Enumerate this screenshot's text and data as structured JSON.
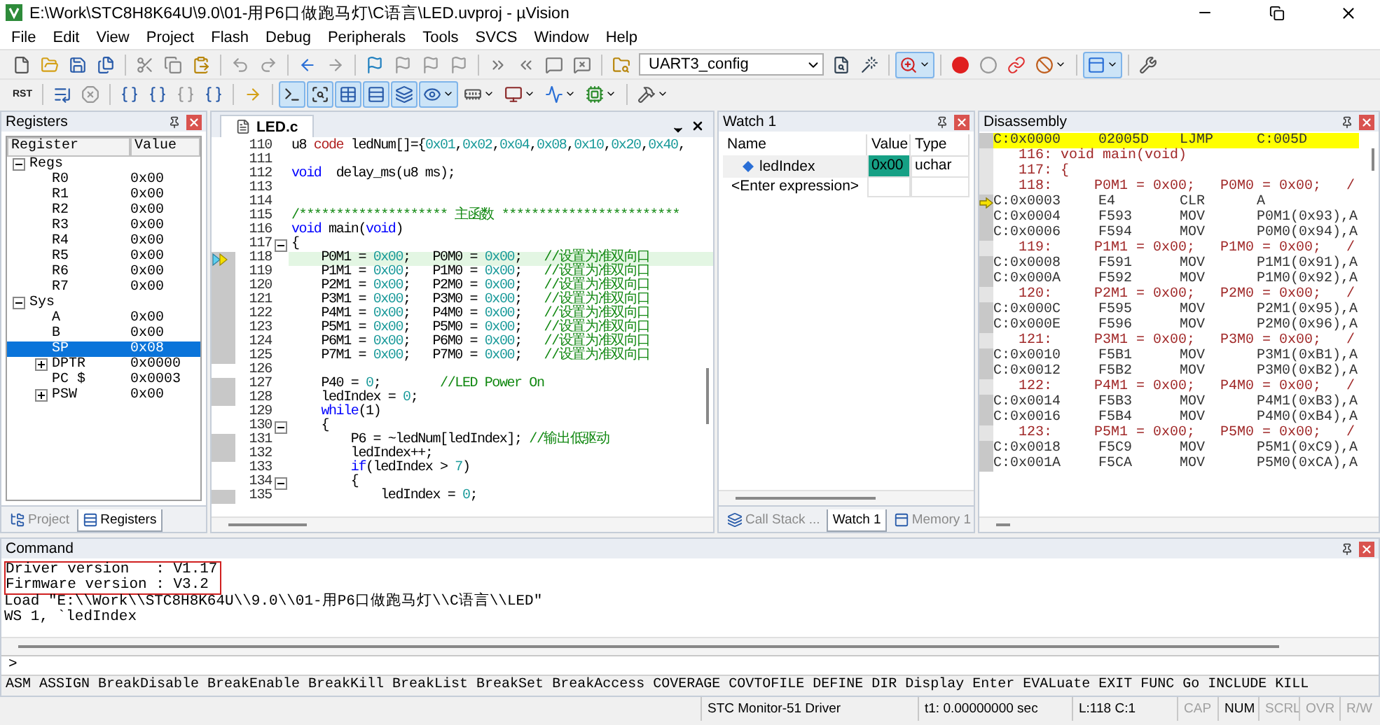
{
  "window": {
    "title": "E:\\Work\\STC8H8K64U\\9.0\\01-用P6口做跑马灯\\C语言\\LED.uvproj - µVision"
  },
  "menu": [
    "File",
    "Edit",
    "View",
    "Project",
    "Flash",
    "Debug",
    "Peripherals",
    "Tools",
    "SVCS",
    "Window",
    "Help"
  ],
  "toolbar_1": [
    {
      "kind": "button",
      "pressed": false
    },
    {
      "kind": "button",
      "pressed": false
    },
    {
      "kind": "button",
      "pressed": false
    },
    {
      "kind": "button",
      "pressed": false
    },
    {
      "kind": "separator"
    },
    {
      "kind": "button",
      "pressed": false
    },
    {
      "kind": "button",
      "pressed": false
    },
    {
      "kind": "button",
      "pressed": false
    },
    {
      "kind": "separator"
    },
    {
      "kind": "button",
      "pressed": false
    },
    {
      "kind": "button",
      "pressed": false
    },
    {
      "kind": "separator"
    },
    {
      "kind": "button",
      "pressed": false
    },
    {
      "kind": "button",
      "pressed": false
    },
    {
      "kind": "separator"
    },
    {
      "kind": "button",
      "pressed": false
    },
    {
      "kind": "button",
      "pressed": false
    },
    {
      "kind": "button",
      "pressed": false
    },
    {
      "kind": "button",
      "pressed": false
    },
    {
      "kind": "separator"
    },
    {
      "kind": "button",
      "pressed": false
    },
    {
      "kind": "button",
      "pressed": false
    },
    {
      "kind": "button",
      "pressed": false
    },
    {
      "kind": "button",
      "pressed": false
    },
    {
      "kind": "separator"
    },
    {
      "kind": "button",
      "pressed": false
    },
    {
      "kind": "select",
      "value": "UART3_config"
    },
    {
      "kind": "button",
      "pressed": false
    },
    {
      "kind": "button",
      "pressed": false
    },
    {
      "kind": "separator"
    },
    {
      "kind": "split",
      "pressed": true
    },
    {
      "kind": "separator"
    },
    {
      "kind": "button",
      "pressed": false
    },
    {
      "kind": "button",
      "pressed": false
    },
    {
      "kind": "button",
      "pressed": false
    },
    {
      "kind": "split",
      "pressed": false
    },
    {
      "kind": "separator"
    },
    {
      "kind": "split",
      "pressed": true
    },
    {
      "kind": "separator"
    },
    {
      "kind": "button",
      "pressed": false
    }
  ],
  "toolbar_2": [
    {
      "kind": "text_button",
      "label": "RST"
    },
    {
      "kind": "separator"
    },
    {
      "kind": "button",
      "pressed": false
    },
    {
      "kind": "button",
      "pressed": false
    },
    {
      "kind": "separator"
    },
    {
      "kind": "button",
      "pressed": false
    },
    {
      "kind": "button",
      "pressed": false
    },
    {
      "kind": "button",
      "pressed": false
    },
    {
      "kind": "button",
      "pressed": false
    },
    {
      "kind": "separator"
    },
    {
      "kind": "button",
      "pressed": false
    },
    {
      "kind": "separator"
    },
    {
      "kind": "button",
      "pressed": true
    },
    {
      "kind": "button",
      "pressed": true
    },
    {
      "kind": "button",
      "pressed": true
    },
    {
      "kind": "button",
      "pressed": true
    },
    {
      "kind": "button",
      "pressed": true
    },
    {
      "kind": "split",
      "pressed": true
    },
    {
      "kind": "split",
      "pressed": false
    },
    {
      "kind": "split",
      "pressed": false
    },
    {
      "kind": "split",
      "pressed": false
    },
    {
      "kind": "split",
      "pressed": false
    },
    {
      "kind": "separator"
    },
    {
      "kind": "split",
      "pressed": false
    }
  ],
  "registers": {
    "title": "Registers",
    "columns": [
      "Register",
      "Value"
    ],
    "rows": [
      {
        "name": "Regs",
        "expanded": true,
        "selected": false,
        "children": [
          {
            "name": "R0",
            "value": "0x00",
            "selected": false
          },
          {
            "name": "R1",
            "value": "0x00",
            "selected": false
          },
          {
            "name": "R2",
            "value": "0x00",
            "selected": false
          },
          {
            "name": "R3",
            "value": "0x00",
            "selected": false
          },
          {
            "name": "R4",
            "value": "0x00",
            "selected": false
          },
          {
            "name": "R5",
            "value": "0x00",
            "selected": false
          },
          {
            "name": "R6",
            "value": "0x00",
            "selected": false
          },
          {
            "name": "R7",
            "value": "0x00",
            "selected": false
          }
        ]
      },
      {
        "name": "Sys",
        "expanded": true,
        "selected": false,
        "children": [
          {
            "name": "A",
            "value": "0x00",
            "selected": false
          },
          {
            "name": "B",
            "value": "0x00",
            "selected": false
          },
          {
            "name": "SP",
            "value": "0x08",
            "selected": true
          },
          {
            "name": "DPTR",
            "value": "0x0000",
            "expanded": false,
            "selected": false
          },
          {
            "name": "PC $",
            "value": "0x0003",
            "selected": false
          },
          {
            "name": "PSW",
            "value": "0x00",
            "expanded": false,
            "selected": false
          }
        ]
      }
    ],
    "tabs": [
      {
        "label": "Project",
        "selected": false
      },
      {
        "label": "Registers",
        "selected": true
      }
    ]
  },
  "editor": {
    "tabs": [
      {
        "label": "LED.c",
        "selected": true
      }
    ],
    "lines": [
      {
        "number": "110",
        "executable": false,
        "current": false,
        "code": [
          {
            "kind": "plain",
            "text": "u8 "
          },
          {
            "kind": "storage",
            "text": "code"
          },
          {
            "kind": "plain",
            "text": " ledNum[]={"
          },
          {
            "kind": "number",
            "text": "0x01"
          },
          {
            "kind": "plain",
            "text": ","
          },
          {
            "kind": "number",
            "text": "0x02"
          },
          {
            "kind": "plain",
            "text": ","
          },
          {
            "kind": "number",
            "text": "0x04"
          },
          {
            "kind": "plain",
            "text": ","
          },
          {
            "kind": "number",
            "text": "0x08"
          },
          {
            "kind": "plain",
            "text": ","
          },
          {
            "kind": "number",
            "text": "0x10"
          },
          {
            "kind": "plain",
            "text": ","
          },
          {
            "kind": "number",
            "text": "0x20"
          },
          {
            "kind": "plain",
            "text": ","
          },
          {
            "kind": "number",
            "text": "0x40"
          },
          {
            "kind": "plain",
            "text": ","
          }
        ]
      },
      {
        "number": "111",
        "executable": false,
        "current": false
      },
      {
        "number": "112",
        "executable": false,
        "current": false,
        "code": [
          {
            "kind": "keyword",
            "text": "void"
          },
          {
            "kind": "plain",
            "text": "  delay_ms(u8 ms);"
          }
        ]
      },
      {
        "number": "113",
        "executable": false,
        "current": false
      },
      {
        "number": "114",
        "executable": false,
        "current": false
      },
      {
        "number": "115",
        "executable": false,
        "current": false,
        "code": [
          {
            "kind": "comment",
            "text": "/******************** 主函数 ************************"
          }
        ]
      },
      {
        "number": "116",
        "executable": false,
        "current": false,
        "code": [
          {
            "kind": "keyword",
            "text": "void"
          },
          {
            "kind": "plain",
            "text": " main("
          },
          {
            "kind": "keyword",
            "text": "void"
          },
          {
            "kind": "plain",
            "text": ")"
          }
        ]
      },
      {
        "number": "117",
        "executable": false,
        "current": false,
        "expanded": true,
        "code": [
          {
            "kind": "plain",
            "text": "{"
          }
        ]
      },
      {
        "number": "118",
        "executable": true,
        "current": true,
        "code": [
          {
            "kind": "plain",
            "text": "    P0M1 = "
          },
          {
            "kind": "number",
            "text": "0x00"
          },
          {
            "kind": "plain",
            "text": ";   P0M0 = "
          },
          {
            "kind": "number",
            "text": "0x00"
          },
          {
            "kind": "plain",
            "text": ";   "
          },
          {
            "kind": "comment",
            "text": "//设置为准双向口"
          }
        ]
      },
      {
        "number": "119",
        "executable": true,
        "current": false,
        "code": [
          {
            "kind": "plain",
            "text": "    P1M1 = "
          },
          {
            "kind": "number",
            "text": "0x00"
          },
          {
            "kind": "plain",
            "text": ";   P1M0 = "
          },
          {
            "kind": "number",
            "text": "0x00"
          },
          {
            "kind": "plain",
            "text": ";   "
          },
          {
            "kind": "comment",
            "text": "//设置为准双向口"
          }
        ]
      },
      {
        "number": "120",
        "executable": true,
        "current": false,
        "code": [
          {
            "kind": "plain",
            "text": "    P2M1 = "
          },
          {
            "kind": "number",
            "text": "0x00"
          },
          {
            "kind": "plain",
            "text": ";   P2M0 = "
          },
          {
            "kind": "number",
            "text": "0x00"
          },
          {
            "kind": "plain",
            "text": ";   "
          },
          {
            "kind": "comment",
            "text": "//设置为准双向口"
          }
        ]
      },
      {
        "number": "121",
        "executable": true,
        "current": false,
        "code": [
          {
            "kind": "plain",
            "text": "    P3M1 = "
          },
          {
            "kind": "number",
            "text": "0x00"
          },
          {
            "kind": "plain",
            "text": ";   P3M0 = "
          },
          {
            "kind": "number",
            "text": "0x00"
          },
          {
            "kind": "plain",
            "text": ";   "
          },
          {
            "kind": "comment",
            "text": "//设置为准双向口"
          }
        ]
      },
      {
        "number": "122",
        "executable": true,
        "current": false,
        "code": [
          {
            "kind": "plain",
            "text": "    P4M1 = "
          },
          {
            "kind": "number",
            "text": "0x00"
          },
          {
            "kind": "plain",
            "text": ";   P4M0 = "
          },
          {
            "kind": "number",
            "text": "0x00"
          },
          {
            "kind": "plain",
            "text": ";   "
          },
          {
            "kind": "comment",
            "text": "//设置为准双向口"
          }
        ]
      },
      {
        "number": "123",
        "executable": true,
        "current": false,
        "code": [
          {
            "kind": "plain",
            "text": "    P5M1 = "
          },
          {
            "kind": "number",
            "text": "0x00"
          },
          {
            "kind": "plain",
            "text": ";   P5M0 = "
          },
          {
            "kind": "number",
            "text": "0x00"
          },
          {
            "kind": "plain",
            "text": ";   "
          },
          {
            "kind": "comment",
            "text": "//设置为准双向口"
          }
        ]
      },
      {
        "number": "124",
        "executable": true,
        "current": false,
        "code": [
          {
            "kind": "plain",
            "text": "    P6M1 = "
          },
          {
            "kind": "number",
            "text": "0x00"
          },
          {
            "kind": "plain",
            "text": ";   P6M0 = "
          },
          {
            "kind": "number",
            "text": "0x00"
          },
          {
            "kind": "plain",
            "text": ";   "
          },
          {
            "kind": "comment",
            "text": "//设置为准双向口"
          }
        ]
      },
      {
        "number": "125",
        "executable": true,
        "current": false,
        "code": [
          {
            "kind": "plain",
            "text": "    P7M1 = "
          },
          {
            "kind": "number",
            "text": "0x00"
          },
          {
            "kind": "plain",
            "text": ";   P7M0 = "
          },
          {
            "kind": "number",
            "text": "0x00"
          },
          {
            "kind": "plain",
            "text": ";   "
          },
          {
            "kind": "comment",
            "text": "//设置为准双向口"
          }
        ]
      },
      {
        "number": "126",
        "executable": false,
        "current": false
      },
      {
        "number": "127",
        "executable": true,
        "current": false,
        "code": [
          {
            "kind": "plain",
            "text": "    P40 = "
          },
          {
            "kind": "number",
            "text": "0"
          },
          {
            "kind": "plain",
            "text": ";        "
          },
          {
            "kind": "comment",
            "text": "//LED Power On"
          }
        ]
      },
      {
        "number": "128",
        "executable": true,
        "current": false,
        "code": [
          {
            "kind": "plain",
            "text": "    ledIndex = "
          },
          {
            "kind": "number",
            "text": "0"
          },
          {
            "kind": "plain",
            "text": ";"
          }
        ]
      },
      {
        "number": "129",
        "executable": false,
        "current": false,
        "code": [
          {
            "kind": "keyword",
            "text": "    while"
          },
          {
            "kind": "plain",
            "text": "(1)"
          }
        ]
      },
      {
        "number": "130",
        "executable": false,
        "current": false,
        "expanded": true,
        "code": [
          {
            "kind": "plain",
            "text": "    {"
          }
        ]
      },
      {
        "number": "131",
        "executable": true,
        "current": false,
        "code": [
          {
            "kind": "plain",
            "text": "        P6 = ~ledNum[ledIndex]; "
          },
          {
            "kind": "comment",
            "text": "//输出低驱动"
          }
        ]
      },
      {
        "number": "132",
        "executable": true,
        "current": false,
        "code": [
          {
            "kind": "plain",
            "text": "        ledIndex++;"
          }
        ]
      },
      {
        "number": "133",
        "executable": false,
        "current": false,
        "code": [
          {
            "kind": "keyword",
            "text": "        if"
          },
          {
            "kind": "plain",
            "text": "(ledIndex > "
          },
          {
            "kind": "number",
            "text": "7"
          },
          {
            "kind": "plain",
            "text": ")"
          }
        ]
      },
      {
        "number": "134",
        "executable": false,
        "current": false,
        "expanded": true,
        "code": [
          {
            "kind": "plain",
            "text": "        {"
          }
        ]
      },
      {
        "number": "135",
        "executable": true,
        "current": false,
        "code": [
          {
            "kind": "plain",
            "text": "            ledIndex = "
          },
          {
            "kind": "number",
            "text": "0"
          },
          {
            "kind": "plain",
            "text": ";"
          }
        ]
      }
    ]
  },
  "watch": {
    "title": "Watch 1",
    "columns": [
      "Name",
      "Value",
      "Type"
    ],
    "rows": [
      {
        "name": "ledIndex",
        "value": "0x00",
        "type": "uchar",
        "changed": true
      }
    ],
    "new_row": {
      "placeholder": "<Enter expression>"
    },
    "tabs": [
      {
        "label": "Call Stack ...",
        "selected": false
      },
      {
        "label": "Watch 1",
        "selected": true
      },
      {
        "label": "Memory 1",
        "selected": false
      }
    ]
  },
  "disassembly": {
    "title": "Disassembly",
    "rows": [
      {
        "kind": "instruction",
        "address": "C:0x0000",
        "opcode": "02005D",
        "mnemonic": "LJMP",
        "operand": "C:005D",
        "highlighted": true,
        "current": false
      },
      {
        "kind": "source",
        "text": "116: void main(void)"
      },
      {
        "kind": "source",
        "text": "117: {"
      },
      {
        "kind": "source",
        "text": "118:     P0M1 = 0x00;   P0M0 = 0x00;   /"
      },
      {
        "kind": "instruction",
        "address": "C:0x0003",
        "opcode": "E4",
        "mnemonic": "CLR",
        "operand": "A",
        "highlighted": false,
        "current": true
      },
      {
        "kind": "instruction",
        "address": "C:0x0004",
        "opcode": "F593",
        "mnemonic": "MOV",
        "operand": "P0M1(0x93),A",
        "highlighted": false,
        "current": false
      },
      {
        "kind": "instruction",
        "address": "C:0x0006",
        "opcode": "F594",
        "mnemonic": "MOV",
        "operand": "P0M0(0x94),A",
        "highlighted": false,
        "current": false
      },
      {
        "kind": "source",
        "text": "119:     P1M1 = 0x00;   P1M0 = 0x00;   /"
      },
      {
        "kind": "instruction",
        "address": "C:0x0008",
        "opcode": "F591",
        "mnemonic": "MOV",
        "operand": "P1M1(0x91),A",
        "highlighted": false,
        "current": false
      },
      {
        "kind": "instruction",
        "address": "C:0x000A",
        "opcode": "F592",
        "mnemonic": "MOV",
        "operand": "P1M0(0x92),A",
        "highlighted": false,
        "current": false
      },
      {
        "kind": "source",
        "text": "120:     P2M1 = 0x00;   P2M0 = 0x00;   /"
      },
      {
        "kind": "instruction",
        "address": "C:0x000C",
        "opcode": "F595",
        "mnemonic": "MOV",
        "operand": "P2M1(0x95),A",
        "highlighted": false,
        "current": false
      },
      {
        "kind": "instruction",
        "address": "C:0x000E",
        "opcode": "F596",
        "mnemonic": "MOV",
        "operand": "P2M0(0x96),A",
        "highlighted": false,
        "current": false
      },
      {
        "kind": "source",
        "text": "121:     P3M1 = 0x00;   P3M0 = 0x00;   /"
      },
      {
        "kind": "instruction",
        "address": "C:0x0010",
        "opcode": "F5B1",
        "mnemonic": "MOV",
        "operand": "P3M1(0xB1),A",
        "highlighted": false,
        "current": false
      },
      {
        "kind": "instruction",
        "address": "C:0x0012",
        "opcode": "F5B2",
        "mnemonic": "MOV",
        "operand": "P3M0(0xB2),A",
        "highlighted": false,
        "current": false
      },
      {
        "kind": "source",
        "text": "122:     P4M1 = 0x00;   P4M0 = 0x00;   /"
      },
      {
        "kind": "instruction",
        "address": "C:0x0014",
        "opcode": "F5B3",
        "mnemonic": "MOV",
        "operand": "P4M1(0xB3),A",
        "highlighted": false,
        "current": false
      },
      {
        "kind": "instruction",
        "address": "C:0x0016",
        "opcode": "F5B4",
        "mnemonic": "MOV",
        "operand": "P4M0(0xB4),A",
        "highlighted": false,
        "current": false
      },
      {
        "kind": "source",
        "text": "123:     P5M1 = 0x00;   P5M0 = 0x00;   /"
      },
      {
        "kind": "instruction",
        "address": "C:0x0018",
        "opcode": "F5C9",
        "mnemonic": "MOV",
        "operand": "P5M1(0xC9),A",
        "highlighted": false,
        "current": false
      },
      {
        "kind": "instruction",
        "address": "C:0x001A",
        "opcode": "F5CA",
        "mnemonic": "MOV",
        "operand": "P5M0(0xCA),A",
        "highlighted": false,
        "current": false
      }
    ]
  },
  "command": {
    "title": "Command",
    "output": [
      {
        "text": "Driver version   : V1.17",
        "boxed": true
      },
      {
        "text": "Firmware version : V3.2",
        "boxed": true
      },
      {
        "text": "Load \"E:\\\\Work\\\\STC8H8K64U\\\\9.0\\\\01-用P6口做跑马灯\\\\C语言\\\\LED\"",
        "boxed": false
      },
      {
        "text": "WS 1, `ledIndex",
        "boxed": false
      }
    ],
    "prompt": ">",
    "commands": "ASM ASSIGN BreakDisable BreakEnable BreakKill BreakList BreakSet BreakAccess COVERAGE COVTOFILE DEFINE DIR Display Enter EVALuate EXIT FUNC Go INCLUDE KILL"
  },
  "status_bar": {
    "fields": [
      "STC Monitor-51 Driver",
      "t1: 0.00000000 sec",
      "L:118 C:1"
    ],
    "indicators": [
      {
        "text": "CAP",
        "active": false
      },
      {
        "text": "NUM",
        "active": true
      },
      {
        "text": "SCRL",
        "active": false
      },
      {
        "text": "OVR",
        "active": false
      },
      {
        "text": "R/W",
        "active": false
      }
    ]
  }
}
